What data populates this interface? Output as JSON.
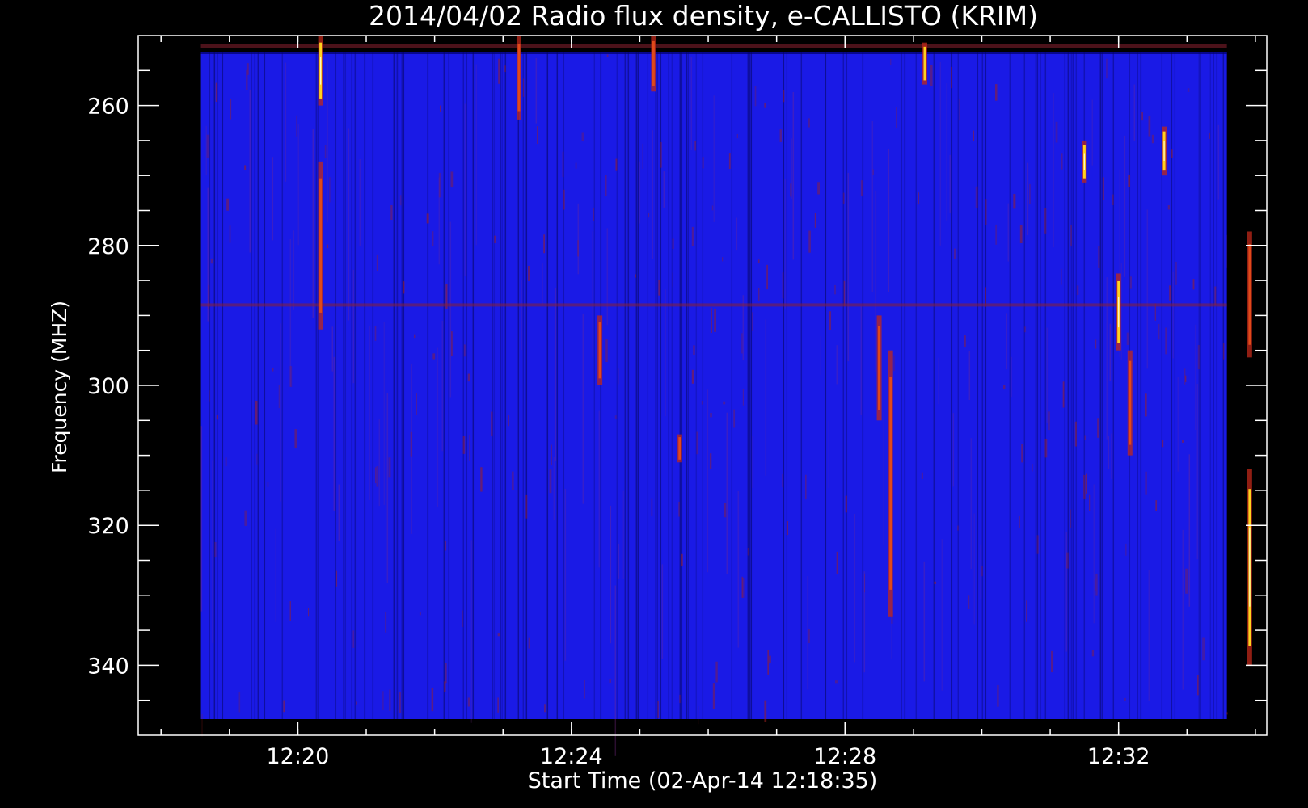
{
  "chart_data": {
    "type": "heatmap",
    "title": "2014/04/02  Radio flux density, e-CALLISTO (KRIM)",
    "xlabel": "Start Time (02-Apr-14 12:18:35)",
    "ylabel": "Frequency (MHZ)",
    "x_time_range": [
      "12:18:35",
      "12:33:35"
    ],
    "xlim": [
      "12:17:40",
      "12:34:10"
    ],
    "ylim": [
      250,
      350
    ],
    "y_inverted": true,
    "x_ticks": [
      "12:20",
      "12:24",
      "12:28",
      "12:32"
    ],
    "y_ticks": [
      260,
      280,
      300,
      320,
      340
    ],
    "grid": false,
    "colormap": {
      "background": "#1a1ae6",
      "mid": "#c0281a",
      "high": "#ffd21e",
      "peak": "#fff6c8"
    },
    "constant_features": [
      {
        "kind": "horizontal-band",
        "freq_mhz": 288.5
      },
      {
        "kind": "horizontal-band",
        "freq_mhz": 251.5
      }
    ],
    "bursts": [
      {
        "time": "12:20:20",
        "f_start": 250,
        "f_end": 260,
        "intensity": 0.95
      },
      {
        "time": "12:20:20",
        "f_start": 268,
        "f_end": 292,
        "intensity": 0.5
      },
      {
        "time": "12:23:14",
        "f_start": 250,
        "f_end": 262,
        "intensity": 0.6
      },
      {
        "time": "12:24:25",
        "f_start": 290,
        "f_end": 300,
        "intensity": 0.65
      },
      {
        "time": "12:25:12",
        "f_start": 250,
        "f_end": 258,
        "intensity": 0.8
      },
      {
        "time": "12:25:35",
        "f_start": 307,
        "f_end": 311,
        "intensity": 0.55
      },
      {
        "time": "12:28:30",
        "f_start": 290,
        "f_end": 305,
        "intensity": 0.55
      },
      {
        "time": "12:28:40",
        "f_start": 295,
        "f_end": 333,
        "intensity": 0.55
      },
      {
        "time": "12:29:10",
        "f_start": 251,
        "f_end": 257,
        "intensity": 0.85
      },
      {
        "time": "12:31:30",
        "f_start": 265,
        "f_end": 271,
        "intensity": 1.0
      },
      {
        "time": "12:32:00",
        "f_start": 284,
        "f_end": 295,
        "intensity": 0.95
      },
      {
        "time": "12:32:10",
        "f_start": 295,
        "f_end": 310,
        "intensity": 0.7
      },
      {
        "time": "12:32:40",
        "f_start": 263,
        "f_end": 270,
        "intensity": 0.9
      },
      {
        "time": "12:33:55",
        "f_start": 278,
        "f_end": 296,
        "intensity": 0.75
      },
      {
        "time": "12:33:55",
        "f_start": 312,
        "f_end": 340,
        "intensity": 1.0
      }
    ]
  }
}
